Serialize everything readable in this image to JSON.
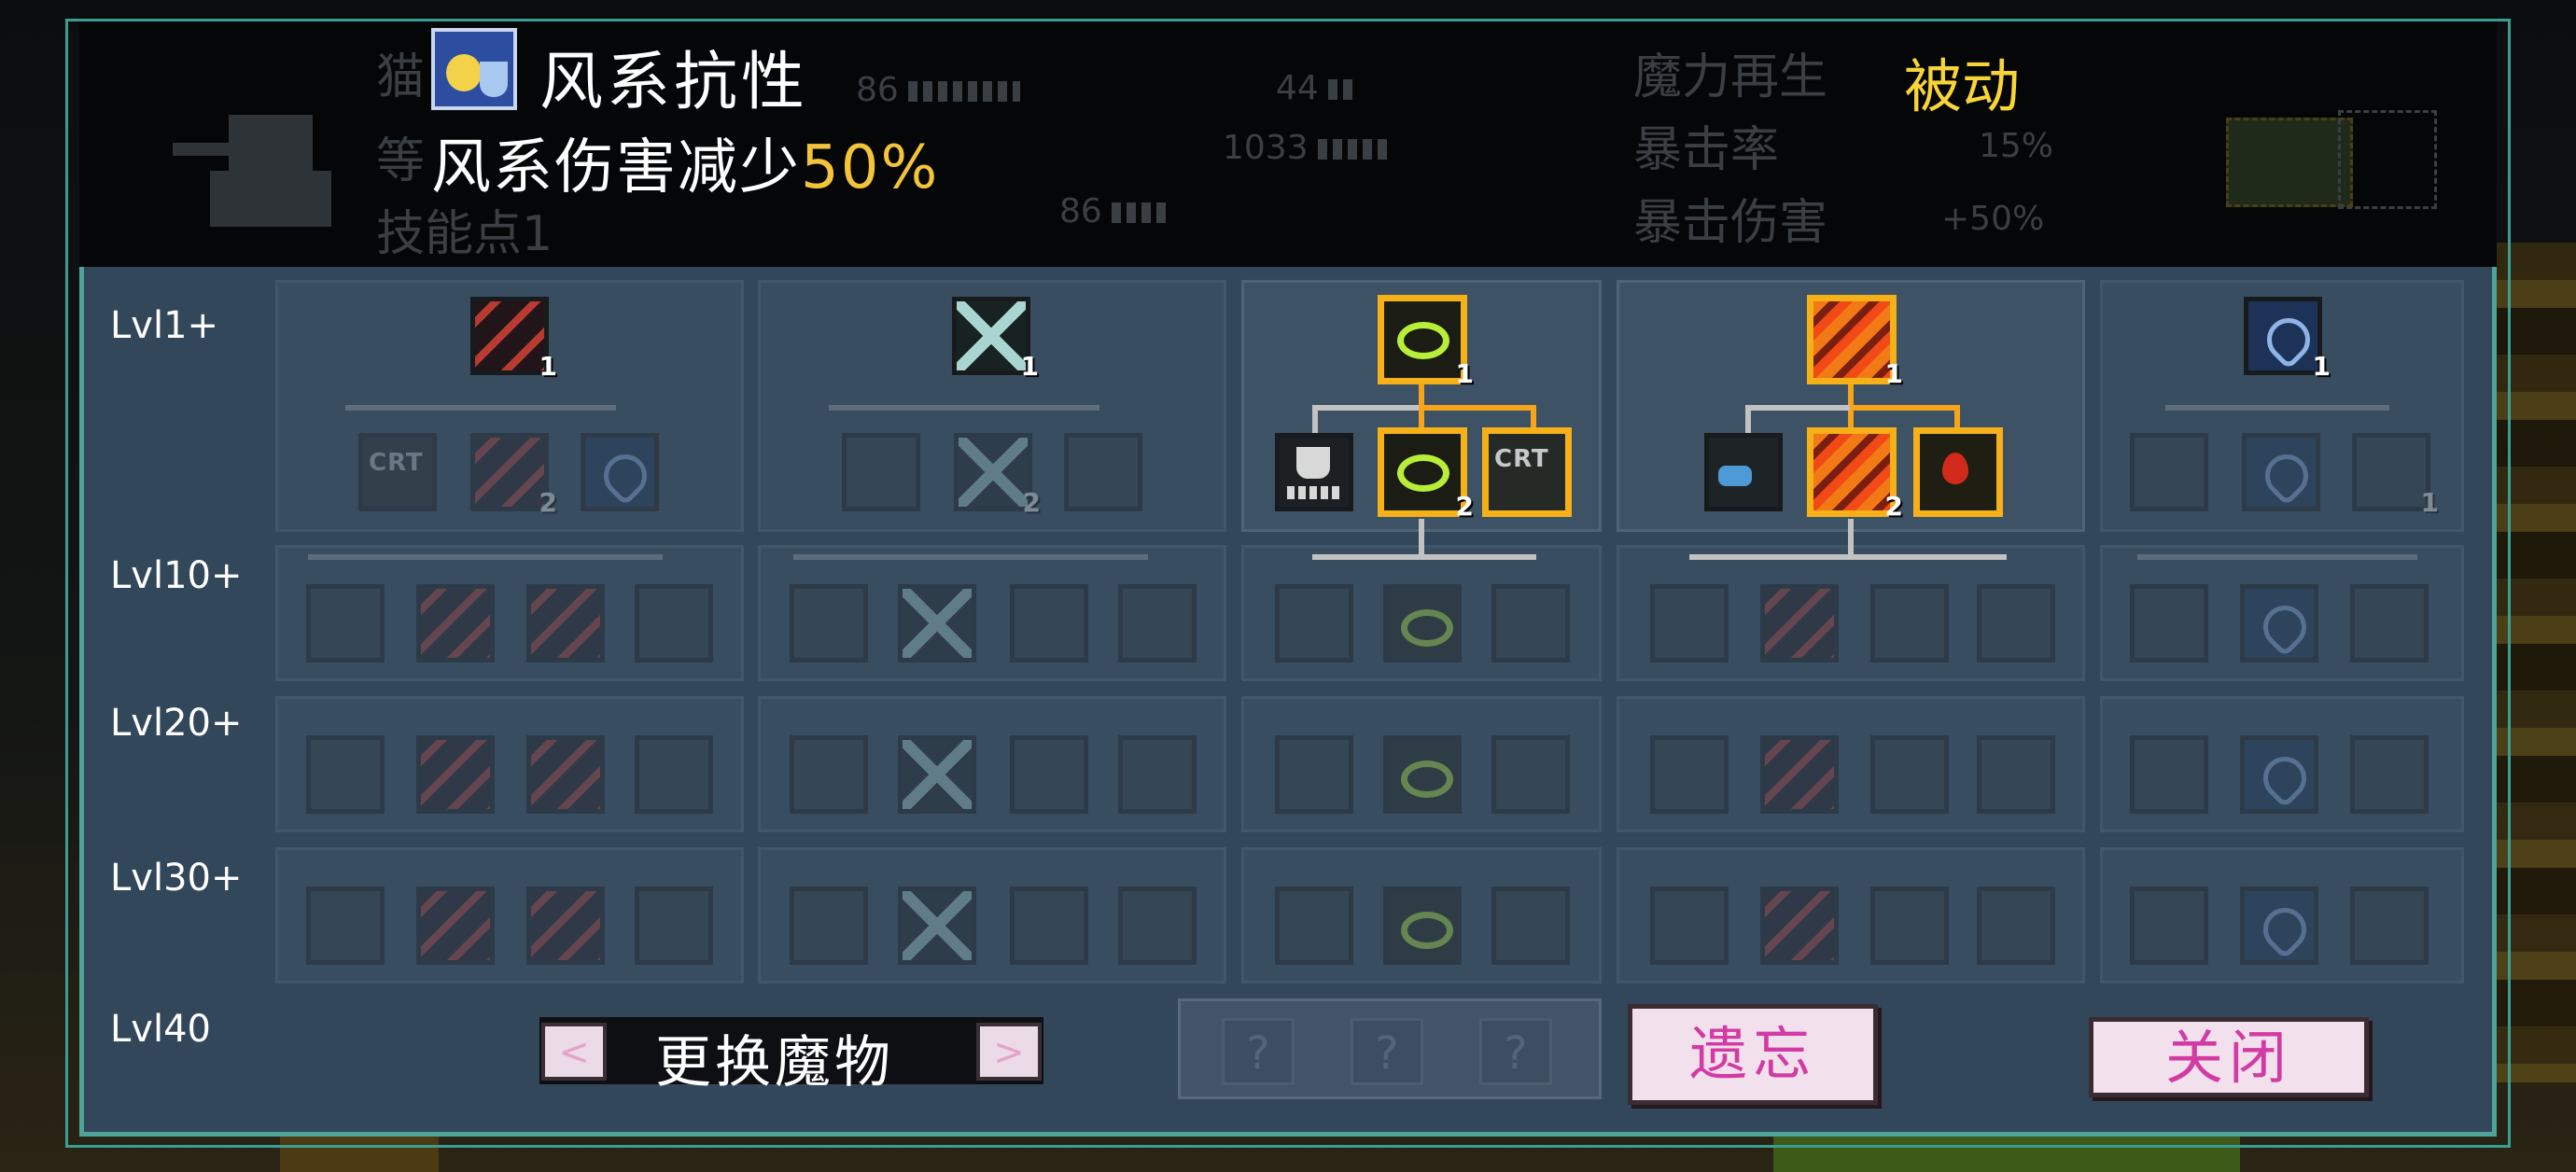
{
  "tooltip": {
    "icon": "wind-resist-icon",
    "title": "风系抗性",
    "desc_prefix": "风系伤害减少",
    "desc_value": "50%"
  },
  "status": {
    "faded_name": "猫",
    "faded_level_label": "等",
    "skill_points": "技能点1",
    "stat1": "86",
    "stat2": "44",
    "stat3": "1033",
    "stat4": "86",
    "mana_regen_label": "魔力再生",
    "mana_regen_value": "被动",
    "crit_rate_label": "暴击率",
    "crit_rate_value": "15%",
    "crit_dmg_label": "暴击伤害",
    "crit_dmg_value": "+50%"
  },
  "levels": [
    "Lvl1+",
    "Lvl10+",
    "Lvl20+",
    "Lvl30+",
    "Lvl40"
  ],
  "columns": [
    {
      "name": "claw-tree",
      "root_count": "1",
      "tier1": [
        "CRT",
        "",
        ""
      ],
      "tier1_counts": [
        "",
        "2",
        ""
      ]
    },
    {
      "name": "x-cut-tree",
      "root_count": "1",
      "tier1_counts": [
        "",
        "2",
        ""
      ]
    },
    {
      "name": "ring-tree",
      "root_count": "1",
      "tier1_counts": [
        "",
        "2",
        ""
      ],
      "crt_text": "CRT"
    },
    {
      "name": "fire-claw-tree",
      "root_count": "1",
      "tier1_counts": [
        "",
        "2",
        ""
      ]
    },
    {
      "name": "heart-tree",
      "root_count": "1",
      "tier1_counts": [
        "",
        "",
        "1"
      ]
    }
  ],
  "buttons": {
    "prev": "<",
    "next": ">",
    "swap_monster": "更换魔物",
    "forget": "遗忘",
    "close": "关闭",
    "q1": "?",
    "q2": "?",
    "q3": "?"
  },
  "colors": {
    "accent_gold": "#f3c43a",
    "selected_border": "#f6b018",
    "panel": "#33475a",
    "frame": "#4fa49a",
    "button_text": "#d23ba4"
  }
}
